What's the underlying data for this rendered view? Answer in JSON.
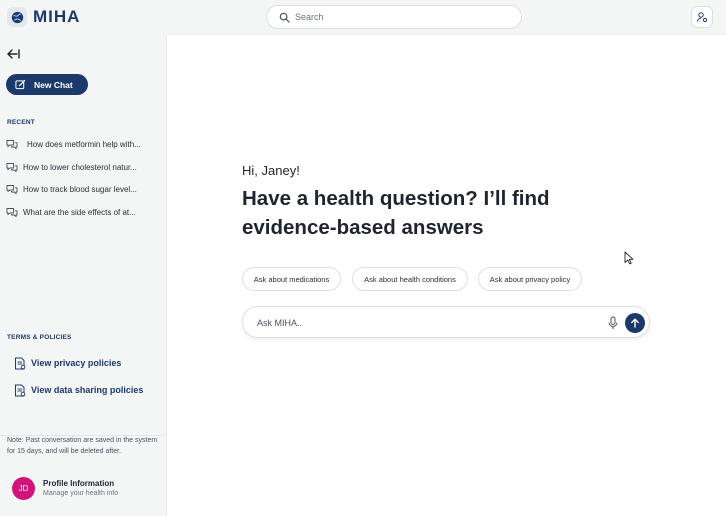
{
  "header": {
    "brand": "MIHA",
    "search_placeholder": "Search",
    "icons": {
      "logo": "globe-logo-icon",
      "search": "search-icon",
      "account": "user-settings-icon"
    }
  },
  "sidebar": {
    "collapse_icon": "collapse-left-icon",
    "new_chat_label": "New Chat",
    "recent_label": "RECENT",
    "recent_items": [
      "How does metformin help with...",
      "How to lower cholesterol natur...",
      "How to track blood sugar level...",
      "What are the side effects of at..."
    ],
    "policies_label": "TERMS & POLICIES",
    "policies": [
      "View privacy policies",
      "View data sharing policies"
    ],
    "note": "Note: Past conversation are saved in the system for 15 days, and will be deleted after.",
    "profile": {
      "initials": "JD",
      "title": "Profile Information",
      "subtitle": "Manage your health info"
    }
  },
  "main": {
    "greeting": "Hi, Janey!",
    "headline": "Have a health question? I’ll find evidence-based answers",
    "suggestions": [
      "Ask about medications",
      "Ask about health conditions",
      "Ask about privacy policy"
    ],
    "ask_placeholder": "Ask MIHA.."
  },
  "colors": {
    "primary": "#1b3a6b",
    "sidebar_bg": "#f4f5f5",
    "avatar": "#d1147c"
  }
}
